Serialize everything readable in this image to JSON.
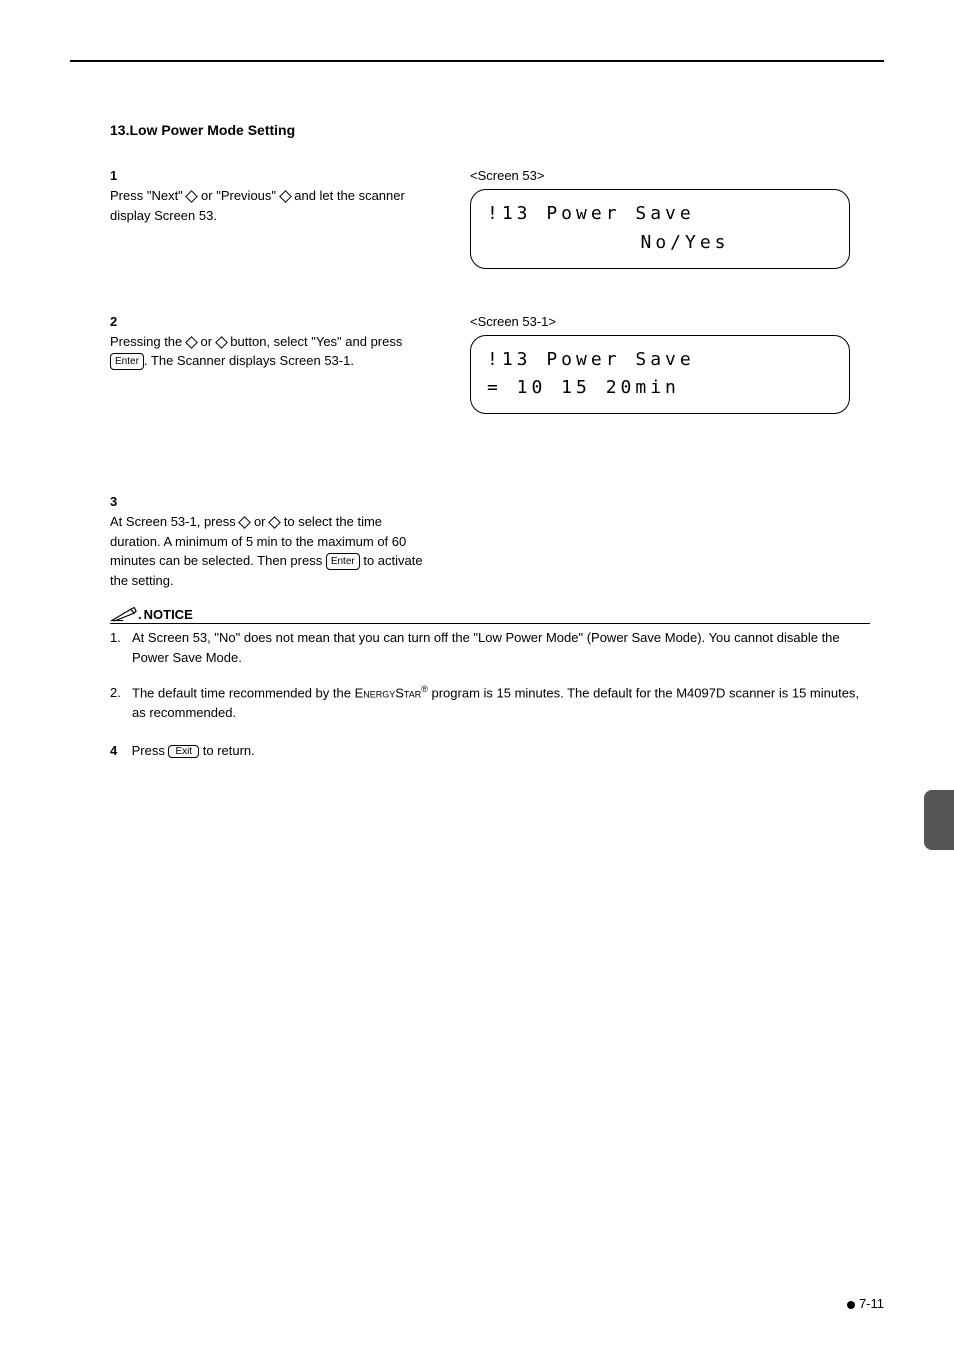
{
  "section_title": "13.Low Power Mode Setting",
  "step1": {
    "num": "1",
    "text_before": "Press \"Next\" ",
    "text_mid": " or \"Previous\" ",
    "text_after": " and let the scanner display Screen 53."
  },
  "screen53": {
    "label": "<Screen 53>",
    "line1": "!13 Power Save",
    "line2": "No/Yes"
  },
  "step2": {
    "num": "2",
    "text_before": "Pressing the ",
    "text_mid": " or ",
    "text_after1": " button, select \"Yes\" and press ",
    "enter": "Enter",
    "text_after2": ". The Scanner displays Screen 53-1."
  },
  "screen531": {
    "label": "<Screen 53-1>",
    "line1": "!13 Power Save",
    "line2": "=  10  15  20min"
  },
  "step3": {
    "num": "3",
    "text_before": "At Screen 53-1, press  ",
    "text_mid": " or ",
    "text_after1": " to select the time duration. A minimum of 5 min to the maximum of 60 minutes can be selected. Then press ",
    "enter": "Enter",
    "text_after2": " to activate the setting."
  },
  "notice_label": "NOTICE",
  "notice1": {
    "num": "1.",
    "text": "At Screen 53, \"No\" does not mean that you can turn off the \"Low Power Mode\" (Power Save Mode). You cannot disable the Power Save Mode."
  },
  "notice2": {
    "num": "2.",
    "text_before": "The default time recommended by the ",
    "energystar": "EnergyStar",
    "text_after": " program is 15 minutes.  The default for the M4097D scanner is 15 minutes, as recommended."
  },
  "step4": {
    "num": "4",
    "text_before": "Press ",
    "exit": "Exit",
    "text_after": " to return."
  },
  "page_num": "7-11"
}
